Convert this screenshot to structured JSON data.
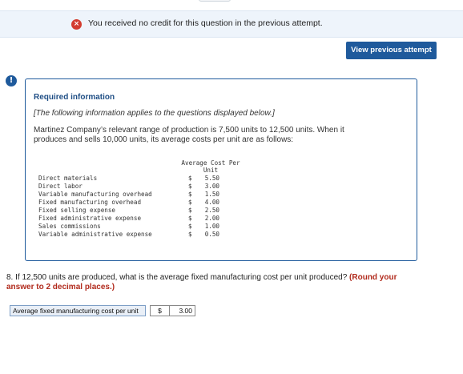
{
  "banner": {
    "icon": "x-icon",
    "text": "You received no credit for this question in the previous attempt."
  },
  "view_previous_label": "View previous attempt",
  "alert_icon": "!",
  "info": {
    "title": "Required information",
    "note": "[The following information applies to the questions displayed below.]",
    "description": "Martinez Company’s relevant range of production is 7,500 units to 12,500 units. When it produces and sells 10,000 units, its average costs per unit are as follows:",
    "column_header": "Average Cost Per Unit",
    "rows": [
      {
        "label": "Direct materials",
        "currency": "$",
        "value": "5.50"
      },
      {
        "label": "Direct labor",
        "currency": "$",
        "value": "3.00"
      },
      {
        "label": "Variable manufacturing overhead",
        "currency": "$",
        "value": "1.50"
      },
      {
        "label": "Fixed manufacturing overhead",
        "currency": "$",
        "value": "4.00"
      },
      {
        "label": "Fixed selling expense",
        "currency": "$",
        "value": "2.50"
      },
      {
        "label": "Fixed administrative expense",
        "currency": "$",
        "value": "2.00"
      },
      {
        "label": "Sales commissions",
        "currency": "$",
        "value": "1.00"
      },
      {
        "label": "Variable administrative expense",
        "currency": "$",
        "value": "0.50"
      }
    ]
  },
  "question": {
    "text": "8. If 12,500 units are produced, what is the average fixed manufacturing cost per unit produced?",
    "note": "(Round your answer to 2 decimal places.)"
  },
  "answer": {
    "label": "Average fixed manufacturing cost per unit",
    "currency": "$",
    "value": "3.00"
  },
  "colors": {
    "brand": "#1f5a9c",
    "error": "#d33c2f",
    "note": "#b12a1c",
    "banner_bg": "#eef4fb"
  }
}
